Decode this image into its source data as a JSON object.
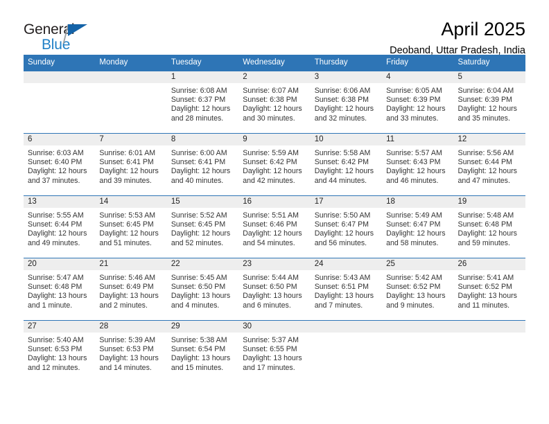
{
  "brand": {
    "name_part1": "General",
    "name_part2": "Blue",
    "triangle_color": "#1463a8",
    "blue_color": "#1f7fc6"
  },
  "header": {
    "title": "April 2025",
    "subtitle": "Deoband, Uttar Pradesh, India"
  },
  "theme": {
    "header_blue": "#2e75b6",
    "band_gray": "#eeeeee",
    "text": "#333333"
  },
  "calendar": {
    "weekdays": [
      "Sunday",
      "Monday",
      "Tuesday",
      "Wednesday",
      "Thursday",
      "Friday",
      "Saturday"
    ],
    "weeks": [
      [
        {
          "day": "",
          "empty": true,
          "sunrise": "",
          "sunset": "",
          "daylight_line1": "",
          "daylight_line2": ""
        },
        {
          "day": "",
          "empty": true,
          "sunrise": "",
          "sunset": "",
          "daylight_line1": "",
          "daylight_line2": ""
        },
        {
          "day": "1",
          "sunrise": "Sunrise: 6:08 AM",
          "sunset": "Sunset: 6:37 PM",
          "daylight_line1": "Daylight: 12 hours",
          "daylight_line2": "and 28 minutes."
        },
        {
          "day": "2",
          "sunrise": "Sunrise: 6:07 AM",
          "sunset": "Sunset: 6:38 PM",
          "daylight_line1": "Daylight: 12 hours",
          "daylight_line2": "and 30 minutes."
        },
        {
          "day": "3",
          "sunrise": "Sunrise: 6:06 AM",
          "sunset": "Sunset: 6:38 PM",
          "daylight_line1": "Daylight: 12 hours",
          "daylight_line2": "and 32 minutes."
        },
        {
          "day": "4",
          "sunrise": "Sunrise: 6:05 AM",
          "sunset": "Sunset: 6:39 PM",
          "daylight_line1": "Daylight: 12 hours",
          "daylight_line2": "and 33 minutes."
        },
        {
          "day": "5",
          "sunrise": "Sunrise: 6:04 AM",
          "sunset": "Sunset: 6:39 PM",
          "daylight_line1": "Daylight: 12 hours",
          "daylight_line2": "and 35 minutes."
        }
      ],
      [
        {
          "day": "6",
          "sunrise": "Sunrise: 6:03 AM",
          "sunset": "Sunset: 6:40 PM",
          "daylight_line1": "Daylight: 12 hours",
          "daylight_line2": "and 37 minutes."
        },
        {
          "day": "7",
          "sunrise": "Sunrise: 6:01 AM",
          "sunset": "Sunset: 6:41 PM",
          "daylight_line1": "Daylight: 12 hours",
          "daylight_line2": "and 39 minutes."
        },
        {
          "day": "8",
          "sunrise": "Sunrise: 6:00 AM",
          "sunset": "Sunset: 6:41 PM",
          "daylight_line1": "Daylight: 12 hours",
          "daylight_line2": "and 40 minutes."
        },
        {
          "day": "9",
          "sunrise": "Sunrise: 5:59 AM",
          "sunset": "Sunset: 6:42 PM",
          "daylight_line1": "Daylight: 12 hours",
          "daylight_line2": "and 42 minutes."
        },
        {
          "day": "10",
          "sunrise": "Sunrise: 5:58 AM",
          "sunset": "Sunset: 6:42 PM",
          "daylight_line1": "Daylight: 12 hours",
          "daylight_line2": "and 44 minutes."
        },
        {
          "day": "11",
          "sunrise": "Sunrise: 5:57 AM",
          "sunset": "Sunset: 6:43 PM",
          "daylight_line1": "Daylight: 12 hours",
          "daylight_line2": "and 46 minutes."
        },
        {
          "day": "12",
          "sunrise": "Sunrise: 5:56 AM",
          "sunset": "Sunset: 6:44 PM",
          "daylight_line1": "Daylight: 12 hours",
          "daylight_line2": "and 47 minutes."
        }
      ],
      [
        {
          "day": "13",
          "sunrise": "Sunrise: 5:55 AM",
          "sunset": "Sunset: 6:44 PM",
          "daylight_line1": "Daylight: 12 hours",
          "daylight_line2": "and 49 minutes."
        },
        {
          "day": "14",
          "sunrise": "Sunrise: 5:53 AM",
          "sunset": "Sunset: 6:45 PM",
          "daylight_line1": "Daylight: 12 hours",
          "daylight_line2": "and 51 minutes."
        },
        {
          "day": "15",
          "sunrise": "Sunrise: 5:52 AM",
          "sunset": "Sunset: 6:45 PM",
          "daylight_line1": "Daylight: 12 hours",
          "daylight_line2": "and 52 minutes."
        },
        {
          "day": "16",
          "sunrise": "Sunrise: 5:51 AM",
          "sunset": "Sunset: 6:46 PM",
          "daylight_line1": "Daylight: 12 hours",
          "daylight_line2": "and 54 minutes."
        },
        {
          "day": "17",
          "sunrise": "Sunrise: 5:50 AM",
          "sunset": "Sunset: 6:47 PM",
          "daylight_line1": "Daylight: 12 hours",
          "daylight_line2": "and 56 minutes."
        },
        {
          "day": "18",
          "sunrise": "Sunrise: 5:49 AM",
          "sunset": "Sunset: 6:47 PM",
          "daylight_line1": "Daylight: 12 hours",
          "daylight_line2": "and 58 minutes."
        },
        {
          "day": "19",
          "sunrise": "Sunrise: 5:48 AM",
          "sunset": "Sunset: 6:48 PM",
          "daylight_line1": "Daylight: 12 hours",
          "daylight_line2": "and 59 minutes."
        }
      ],
      [
        {
          "day": "20",
          "sunrise": "Sunrise: 5:47 AM",
          "sunset": "Sunset: 6:48 PM",
          "daylight_line1": "Daylight: 13 hours",
          "daylight_line2": "and 1 minute."
        },
        {
          "day": "21",
          "sunrise": "Sunrise: 5:46 AM",
          "sunset": "Sunset: 6:49 PM",
          "daylight_line1": "Daylight: 13 hours",
          "daylight_line2": "and 2 minutes."
        },
        {
          "day": "22",
          "sunrise": "Sunrise: 5:45 AM",
          "sunset": "Sunset: 6:50 PM",
          "daylight_line1": "Daylight: 13 hours",
          "daylight_line2": "and 4 minutes."
        },
        {
          "day": "23",
          "sunrise": "Sunrise: 5:44 AM",
          "sunset": "Sunset: 6:50 PM",
          "daylight_line1": "Daylight: 13 hours",
          "daylight_line2": "and 6 minutes."
        },
        {
          "day": "24",
          "sunrise": "Sunrise: 5:43 AM",
          "sunset": "Sunset: 6:51 PM",
          "daylight_line1": "Daylight: 13 hours",
          "daylight_line2": "and 7 minutes."
        },
        {
          "day": "25",
          "sunrise": "Sunrise: 5:42 AM",
          "sunset": "Sunset: 6:52 PM",
          "daylight_line1": "Daylight: 13 hours",
          "daylight_line2": "and 9 minutes."
        },
        {
          "day": "26",
          "sunrise": "Sunrise: 5:41 AM",
          "sunset": "Sunset: 6:52 PM",
          "daylight_line1": "Daylight: 13 hours",
          "daylight_line2": "and 11 minutes."
        }
      ],
      [
        {
          "day": "27",
          "sunrise": "Sunrise: 5:40 AM",
          "sunset": "Sunset: 6:53 PM",
          "daylight_line1": "Daylight: 13 hours",
          "daylight_line2": "and 12 minutes."
        },
        {
          "day": "28",
          "sunrise": "Sunrise: 5:39 AM",
          "sunset": "Sunset: 6:53 PM",
          "daylight_line1": "Daylight: 13 hours",
          "daylight_line2": "and 14 minutes."
        },
        {
          "day": "29",
          "sunrise": "Sunrise: 5:38 AM",
          "sunset": "Sunset: 6:54 PM",
          "daylight_line1": "Daylight: 13 hours",
          "daylight_line2": "and 15 minutes."
        },
        {
          "day": "30",
          "sunrise": "Sunrise: 5:37 AM",
          "sunset": "Sunset: 6:55 PM",
          "daylight_line1": "Daylight: 13 hours",
          "daylight_line2": "and 17 minutes."
        },
        {
          "day": "",
          "empty": true,
          "sunrise": "",
          "sunset": "",
          "daylight_line1": "",
          "daylight_line2": ""
        },
        {
          "day": "",
          "empty": true,
          "sunrise": "",
          "sunset": "",
          "daylight_line1": "",
          "daylight_line2": ""
        },
        {
          "day": "",
          "empty": true,
          "sunrise": "",
          "sunset": "",
          "daylight_line1": "",
          "daylight_line2": ""
        }
      ]
    ]
  }
}
